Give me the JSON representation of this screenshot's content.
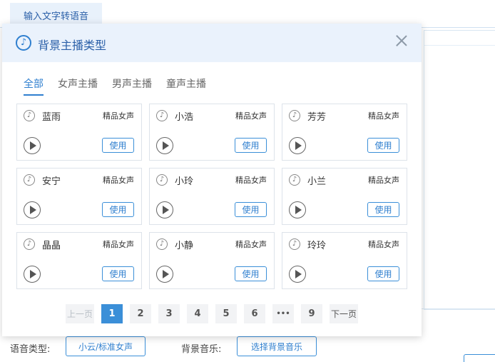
{
  "page": {
    "top_tab_label": "输入文字转语音"
  },
  "popup": {
    "title": "背景主播类型",
    "music_icon": "♪"
  },
  "tabs": [
    {
      "label": "全部",
      "active": true
    },
    {
      "label": "女声主播",
      "active": false
    },
    {
      "label": "男声主播",
      "active": false
    },
    {
      "label": "童声主播",
      "active": false
    }
  ],
  "cards": [
    {
      "name": "蓝雨",
      "type": "精品女声",
      "use_label": "使用"
    },
    {
      "name": "小浩",
      "type": "精品女声",
      "use_label": "使用"
    },
    {
      "name": "芳芳",
      "type": "精品女声",
      "use_label": "使用"
    },
    {
      "name": "安宁",
      "type": "精品女声",
      "use_label": "使用"
    },
    {
      "name": "小玲",
      "type": "精品女声",
      "use_label": "使用"
    },
    {
      "name": "小兰",
      "type": "精品女声",
      "use_label": "使用"
    },
    {
      "name": "晶晶",
      "type": "精品女声",
      "use_label": "使用"
    },
    {
      "name": "小静",
      "type": "精品女声",
      "use_label": "使用"
    },
    {
      "name": "玲玲",
      "type": "精品女声",
      "use_label": "使用"
    }
  ],
  "pagination": {
    "prev_label": "上一页",
    "next_label": "下一页",
    "pages": [
      "1",
      "2",
      "3",
      "4",
      "5",
      "6",
      "•••",
      "9"
    ],
    "current_page": "1"
  },
  "bottom": {
    "voice_type_label": "语音类型:",
    "voice_type_value": "小云/标准女声",
    "bg_music_label": "背景音乐:",
    "bg_music_button": "选择背景音乐"
  },
  "colors": {
    "accent": "#2f7fcf",
    "header_bg": "#eaf2fc",
    "active_page": "#3b8fd8"
  }
}
